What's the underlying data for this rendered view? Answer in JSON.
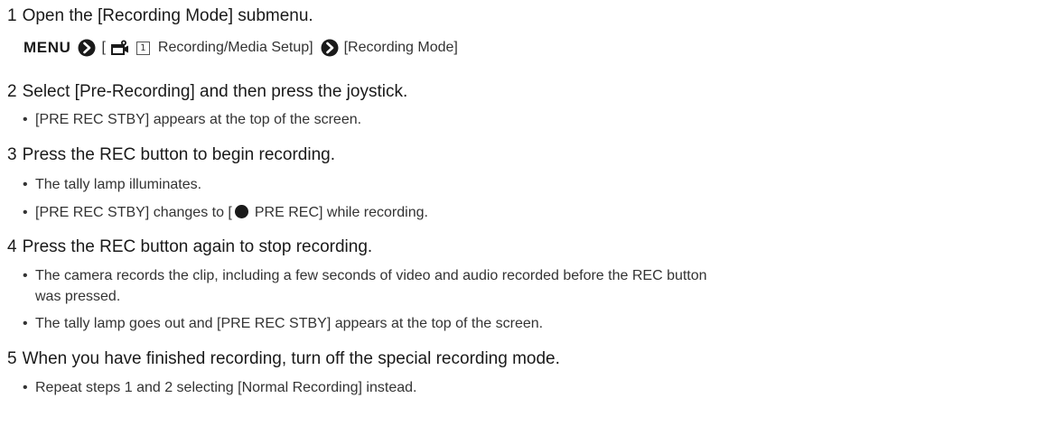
{
  "step1": {
    "number": "1",
    "text": "Open the [Recording Mode] submenu.",
    "menu_path": {
      "menu_label": "MENU",
      "bracket_open": "[",
      "tab_number": "1",
      "section": "Recording/Media Setup]",
      "item": "[Recording Mode]"
    }
  },
  "step2": {
    "number": "2",
    "text": "Select [Pre-Recording] and then press the joystick.",
    "bullets": [
      "[PRE REC STBY] appears at the top of the screen."
    ]
  },
  "step3": {
    "number": "3",
    "text": "Press the REC button to begin recording.",
    "bullets": [
      "The tally lamp illuminates."
    ],
    "rec_bullet": {
      "before": "[PRE REC STBY] changes to [",
      "after": "PRE REC] while recording."
    }
  },
  "step4": {
    "number": "4",
    "text": "Press the REC button again to stop recording.",
    "bullets": [
      "The camera records the clip, including a few seconds of video and audio recorded before the REC button",
      "The tally lamp goes out and [PRE REC STBY] appears at the top of the screen."
    ],
    "bullet1_cont": "was pressed."
  },
  "step5": {
    "number": "5",
    "text": "When you have finished recording, turn off the special recording mode.",
    "bullets": [
      "Repeat steps 1 and 2 selecting [Normal Recording] instead."
    ]
  },
  "bullet_glyph": "•"
}
